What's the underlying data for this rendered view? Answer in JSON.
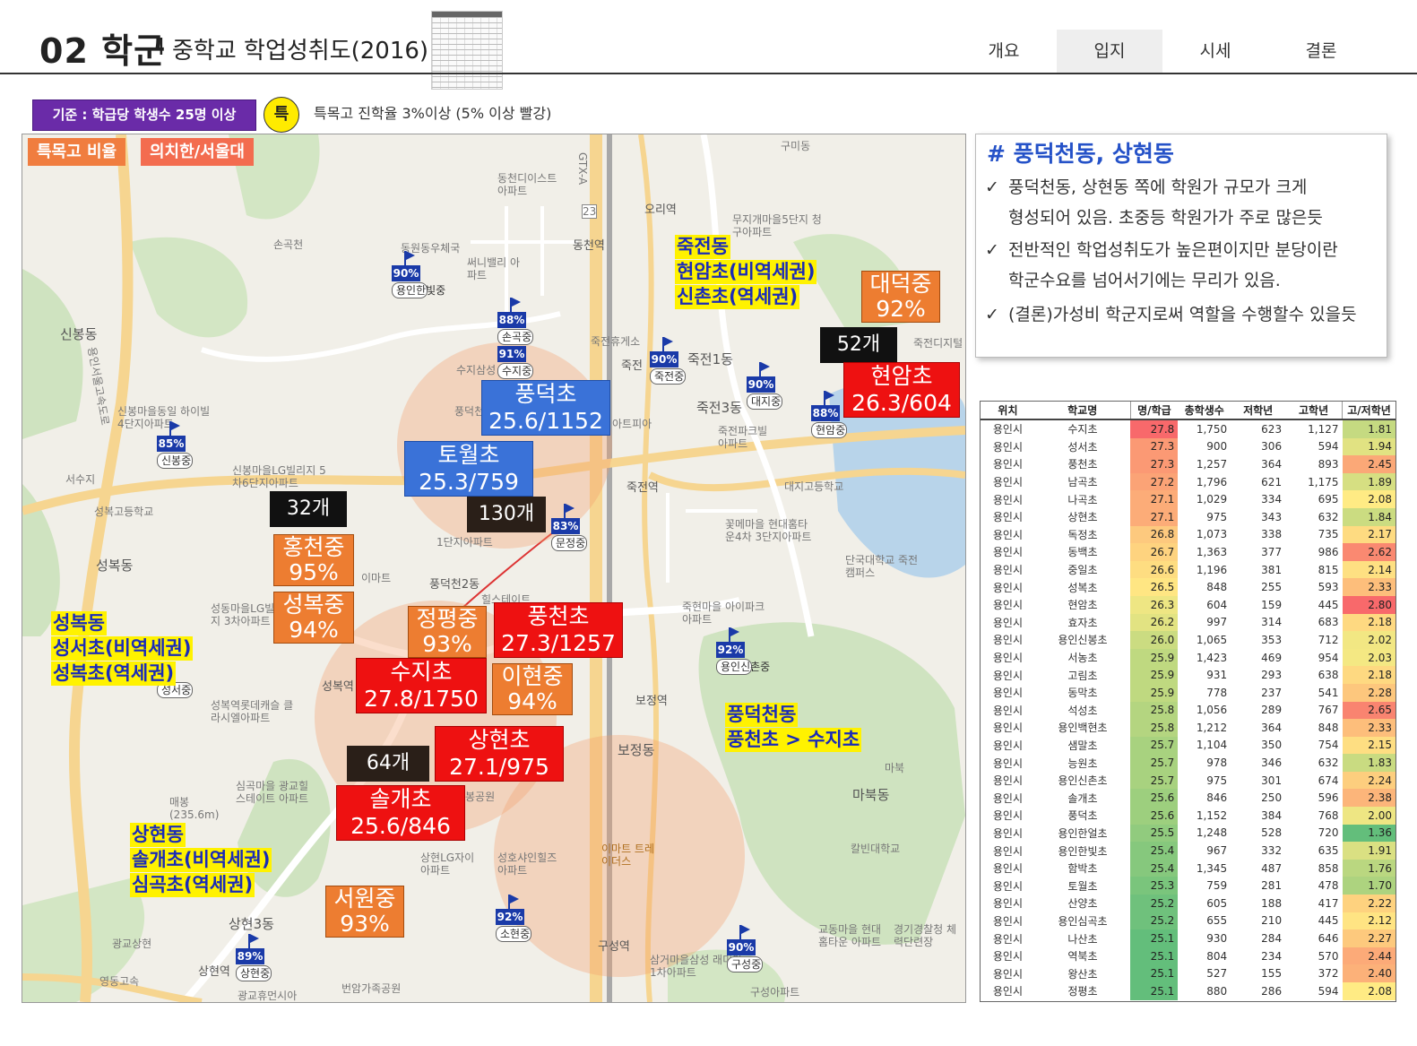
{
  "header": {
    "section_number": "02 학군",
    "separator": "I",
    "subtitle": "중학교 학업성취도(2016)",
    "tabs": [
      {
        "label": "개요",
        "active": false
      },
      {
        "label": "입지",
        "active": true
      },
      {
        "label": "시세",
        "active": false
      },
      {
        "label": "결론",
        "active": false
      }
    ]
  },
  "criteria": {
    "box_label": "기준 : 학급당 학생수 25명 이상",
    "badge": "특",
    "note": "특목고 진학율 3%이상 (5% 이상 빨강)"
  },
  "map": {
    "legend": {
      "special_ratio": "특목고 비율",
      "medical": "의치한/서울대"
    },
    "places": [
      "구미동",
      "동천디이스트 아파트",
      "오리역",
      "무지개마을5단지 청구아파트",
      "손곡천",
      "동천역",
      "써니밸리 아파트",
      "신봉동",
      "용인서울고속도로",
      "신봉마을동일 하이빌4단지아파트",
      "신봉마을LG빌리지 5차6단지아파트",
      "서수지",
      "성복고등학교",
      "성복동",
      "죽전휴게소",
      "죽전1동",
      "죽전3동",
      "죽전파크빌 아파트",
      "죽전디지털",
      "죽전역",
      "대지고등학교",
      "꽃메마을 현대홈타운4차 3단지아파트",
      "단국대학교 죽전캠퍼스",
      "죽현마을 아이파크아파트",
      "성동마을LG빌리지 3차아파트",
      "이마트",
      "성복역롯데캐슬 클라시엘아파트",
      "성복역",
      "보정역",
      "보정동",
      "마북동",
      "심곡마을 광교힐스테이트 아파트",
      "매봉(235.6m)",
      "상현LG자이 아파트",
      "성호샤인힐즈 아파트",
      "이마트 트레이더스",
      "칼빈대학교",
      "상현3동",
      "광교상현",
      "상현역",
      "번암가족공원",
      "구성역",
      "삼거마을삼성 래미안1차아파트",
      "구성아파트",
      "교동마을 현대홈타운 아파트",
      "경기경찰청 체력단련장",
      "광교휴먼시아",
      "영동고속",
      "동원동우체국",
      "1단지아파트",
      "풍덕천2동",
      "마북",
      "GTX-A",
      "23",
      "수지삼성",
      "풍덕천",
      "아트피아",
      "봉공원",
      "힐스테이트",
      "죽전"
    ],
    "flags": [
      {
        "pct": "90%",
        "name": "용인한빛중"
      },
      {
        "pct": "88%",
        "name": "손곡중"
      },
      {
        "pct": "91%",
        "name": "수지중"
      },
      {
        "pct": "90%",
        "name": "죽전중"
      },
      {
        "pct": "90%",
        "name": "대지중"
      },
      {
        "pct": "88%",
        "name": "현암중"
      },
      {
        "pct": "85%",
        "name": "신봉중"
      },
      {
        "pct": "83%",
        "name": "문정중"
      },
      {
        "pct": "92%",
        "name": "용인신촌중"
      },
      {
        "pct": "92%",
        "name": "소현중"
      },
      {
        "pct": "89%",
        "name": "상현중"
      },
      {
        "pct": "90%",
        "name": "구성중"
      },
      {
        "pct": "",
        "name": "성서중"
      },
      {
        "pct": "",
        "name": "홍천중"
      }
    ],
    "labels": {
      "daedeok": {
        "name": "대덕중",
        "value": "92%"
      },
      "hyeonam_count": "52개",
      "hyeonam": {
        "name": "현암초",
        "value": "26.3/604"
      },
      "pungdeok": {
        "name": "풍덕초",
        "value": "25.6/1152"
      },
      "towol": {
        "name": "토월초",
        "value": "25.3/759"
      },
      "count_32": "32개",
      "count_130": "130개",
      "hongcheon": {
        "name": "홍천중",
        "value": "95%"
      },
      "seongbok": {
        "name": "성복중",
        "value": "94%"
      },
      "jeongpyeong": {
        "name": "정평중",
        "value": "93%"
      },
      "pungcheon": {
        "name": "풍천초",
        "value": "27.3/1257"
      },
      "suji": {
        "name": "수지초",
        "value": "27.8/1750"
      },
      "ihyeon": {
        "name": "이현중",
        "value": "94%"
      },
      "sanghyeon": {
        "name": "상현초",
        "value": "27.1/975"
      },
      "count_64": "64개",
      "solgae": {
        "name": "솔개초",
        "value": "25.6/846"
      },
      "seowon": {
        "name": "서원중",
        "value": "93%"
      }
    },
    "areas": {
      "jukjeon": [
        "죽전동",
        "현암초(비역세권)",
        "신촌초(역세권)"
      ],
      "seongbok": [
        "성복동",
        "성서초(비역세권)",
        "성복초(역세권)"
      ],
      "pungdeokcheon": [
        "풍덕천동",
        "풍천초 > 수지초"
      ],
      "sanghyeon": [
        "상현동",
        "솔개초(비역세권)",
        "심곡초(역세권)"
      ]
    }
  },
  "panel": {
    "title": "# 풍덕천동, 상현동",
    "check": "✓",
    "bullets": [
      [
        "풍덕천동, 상현동 쪽에 학원가 규모가 크게",
        "형성되어 있음. 초중등 학원가가 주로 많은듯"
      ],
      [
        "전반적인 학업성취도가 높은편이지만 분당이란",
        "학군수요를 넘어서기에는 무리가 있음."
      ],
      [
        "(결론)가성비 학군지로써 역할을 수행할수 있을듯"
      ]
    ]
  },
  "table": {
    "headers": [
      "위치",
      "학교명",
      "명/학급",
      "총학생수",
      "저학년",
      "고학년",
      "고/저학년"
    ],
    "rows": [
      [
        "용인시",
        "수지초",
        "27.8",
        "1,750",
        "623",
        "1,127",
        "1.81"
      ],
      [
        "용인시",
        "성서초",
        "27.3",
        "900",
        "306",
        "594",
        "1.94"
      ],
      [
        "용인시",
        "풍천초",
        "27.3",
        "1,257",
        "364",
        "893",
        "2.45"
      ],
      [
        "용인시",
        "남곡초",
        "27.2",
        "1,796",
        "621",
        "1,175",
        "1.89"
      ],
      [
        "용인시",
        "나곡초",
        "27.1",
        "1,029",
        "334",
        "695",
        "2.08"
      ],
      [
        "용인시",
        "상현초",
        "27.1",
        "975",
        "343",
        "632",
        "1.84"
      ],
      [
        "용인시",
        "독정초",
        "26.8",
        "1,073",
        "338",
        "735",
        "2.17"
      ],
      [
        "용인시",
        "동백초",
        "26.7",
        "1,363",
        "377",
        "986",
        "2.62"
      ],
      [
        "용인시",
        "중일초",
        "26.6",
        "1,196",
        "381",
        "815",
        "2.14"
      ],
      [
        "용인시",
        "성복초",
        "26.5",
        "848",
        "255",
        "593",
        "2.33"
      ],
      [
        "용인시",
        "현암초",
        "26.3",
        "604",
        "159",
        "445",
        "2.80"
      ],
      [
        "용인시",
        "효자초",
        "26.2",
        "997",
        "314",
        "683",
        "2.18"
      ],
      [
        "용인시",
        "용인신봉초",
        "26.0",
        "1,065",
        "353",
        "712",
        "2.02"
      ],
      [
        "용인시",
        "서농초",
        "25.9",
        "1,423",
        "469",
        "954",
        "2.03"
      ],
      [
        "용인시",
        "고림초",
        "25.9",
        "931",
        "293",
        "638",
        "2.18"
      ],
      [
        "용인시",
        "동막초",
        "25.9",
        "778",
        "237",
        "541",
        "2.28"
      ],
      [
        "용인시",
        "석성초",
        "25.8",
        "1,056",
        "289",
        "767",
        "2.65"
      ],
      [
        "용인시",
        "용인백현초",
        "25.8",
        "1,212",
        "364",
        "848",
        "2.33"
      ],
      [
        "용인시",
        "샘말초",
        "25.7",
        "1,104",
        "350",
        "754",
        "2.15"
      ],
      [
        "용인시",
        "능원초",
        "25.7",
        "978",
        "346",
        "632",
        "1.83"
      ],
      [
        "용인시",
        "용인신촌초",
        "25.7",
        "975",
        "301",
        "674",
        "2.24"
      ],
      [
        "용인시",
        "솔개초",
        "25.6",
        "846",
        "250",
        "596",
        "2.38"
      ],
      [
        "용인시",
        "풍덕초",
        "25.6",
        "1,152",
        "384",
        "768",
        "2.00"
      ],
      [
        "용인시",
        "용인한얼초",
        "25.5",
        "1,248",
        "528",
        "720",
        "1.36"
      ],
      [
        "용인시",
        "용인한빛초",
        "25.4",
        "967",
        "332",
        "635",
        "1.91"
      ],
      [
        "용인시",
        "함박초",
        "25.4",
        "1,345",
        "487",
        "858",
        "1.76"
      ],
      [
        "용인시",
        "토월초",
        "25.3",
        "759",
        "281",
        "478",
        "1.70"
      ],
      [
        "용인시",
        "산양초",
        "25.2",
        "605",
        "188",
        "417",
        "2.22"
      ],
      [
        "용인시",
        "용인심곡초",
        "25.2",
        "655",
        "210",
        "445",
        "2.12"
      ],
      [
        "용인시",
        "나산초",
        "25.1",
        "930",
        "284",
        "646",
        "2.27"
      ],
      [
        "용인시",
        "역북초",
        "25.1",
        "804",
        "234",
        "570",
        "2.44"
      ],
      [
        "용인시",
        "왕산초",
        "25.1",
        "527",
        "155",
        "372",
        "2.40"
      ],
      [
        "용인시",
        "정평초",
        "25.1",
        "880",
        "286",
        "594",
        "2.08"
      ]
    ]
  },
  "colors": {
    "purple": "#6a2ba8",
    "red_label": "#ee1111",
    "blue_label": "#3a72d8",
    "orange_label": "#ed7d31",
    "yellow_highlight": "#fff200",
    "flag_blue": "#1a3aa8"
  }
}
